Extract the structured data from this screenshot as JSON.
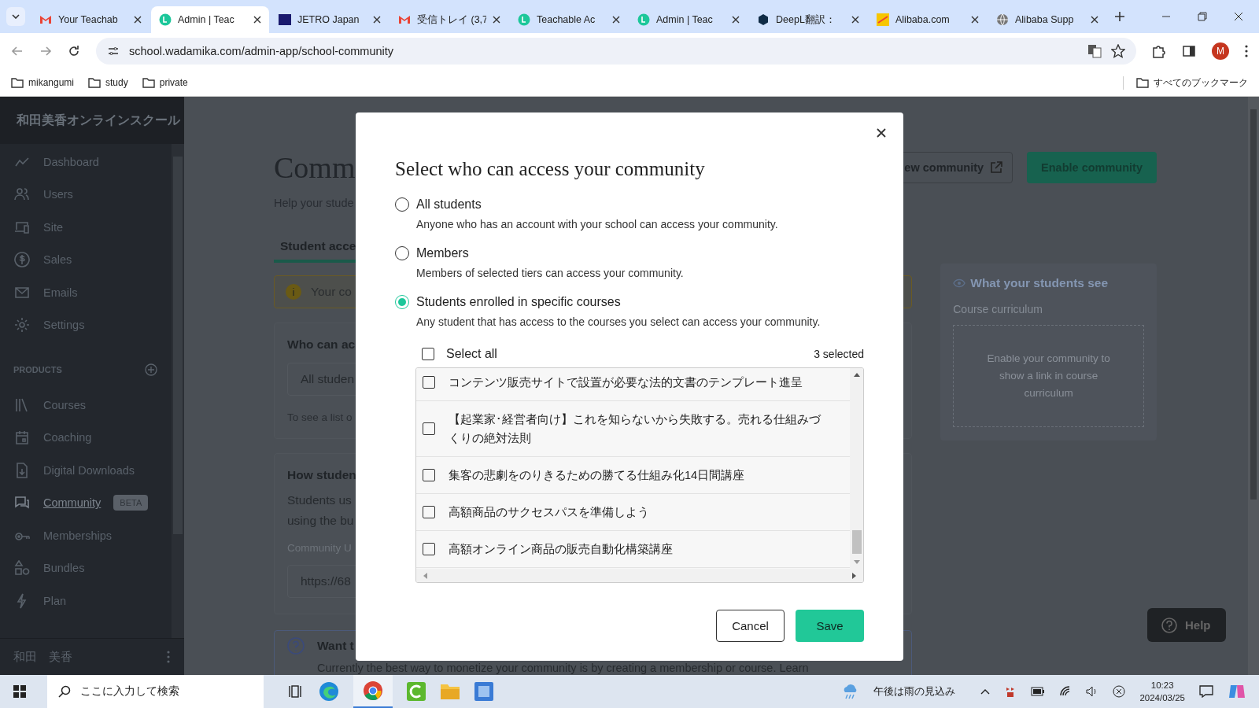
{
  "browser": {
    "tabs": [
      {
        "title": "Your Teachab",
        "kind": "gmail",
        "selected": false
      },
      {
        "title": "Admin | Teac",
        "kind": "teachable",
        "selected": true
      },
      {
        "title": "JETRO Japan",
        "kind": "jetro",
        "selected": false
      },
      {
        "title": "受信トレイ (3,7",
        "kind": "gmail",
        "selected": false
      },
      {
        "title": "Teachable Ac",
        "kind": "teachable",
        "selected": false
      },
      {
        "title": "Admin | Teac",
        "kind": "teachable",
        "selected": false
      },
      {
        "title": "DeepL翻訳：",
        "kind": "deepl",
        "selected": false
      },
      {
        "title": "Alibaba.com",
        "kind": "alibaba",
        "selected": false
      },
      {
        "title": "Alibaba Supp",
        "kind": "globe",
        "selected": false
      }
    ],
    "address": "school.wadamika.com/admin-app/school-community",
    "profile": "M",
    "bookmarks": [
      "mikangumi",
      "study",
      "private"
    ],
    "all_bookmarks": "すべてのブックマーク"
  },
  "sidebar": {
    "brand": "和田美香オンラインスクール",
    "items": [
      {
        "label": "Dashboard",
        "selected": false
      },
      {
        "label": "Users",
        "selected": false
      },
      {
        "label": "Site",
        "selected": false
      },
      {
        "label": "Sales",
        "selected": false
      },
      {
        "label": "Emails",
        "selected": false
      },
      {
        "label": "Settings",
        "selected": false
      }
    ],
    "products_heading": "PRODUCTS",
    "products": [
      {
        "label": "Courses",
        "selected": false
      },
      {
        "label": "Coaching",
        "selected": false
      },
      {
        "label": "Digital Downloads",
        "selected": false
      },
      {
        "label": "Community",
        "selected": true,
        "badge": "BETA"
      },
      {
        "label": "Memberships",
        "selected": false
      },
      {
        "label": "Bundles",
        "selected": false
      },
      {
        "label": "Plan",
        "selected": false
      }
    ],
    "user": "和田　美香"
  },
  "page": {
    "title": "Comm",
    "subtitle": "Help your stude",
    "tab": "Student acce",
    "notice": "Your co",
    "access_card": {
      "heading": "Who can ac",
      "select_value": "All studen",
      "note": "To see a list o"
    },
    "how_card": {
      "heading": "How studen",
      "lines": [
        "Students us",
        "using the bu"
      ],
      "url_label": "Community U",
      "url_value": "https://68"
    },
    "promo": {
      "heading": "Want t",
      "text": "Currently the best way to monetize your community is by creating a membership or course. Learn"
    },
    "view_button": "ew community",
    "enable_button": "Enable community",
    "preview": {
      "heading": "What your students see",
      "label": "Course curriculum",
      "placeholder": "Enable your community to show a link in course curriculum"
    },
    "help": "Help"
  },
  "dialog": {
    "title": "Select who can access your community",
    "options": [
      {
        "label": "All students",
        "description": "Anyone who has an account with your school can access your community.",
        "selected": false
      },
      {
        "label": "Members",
        "description": "Members of selected tiers can access your community.",
        "selected": false
      },
      {
        "label": "Students enrolled in specific courses",
        "description": "Any student that has access to the courses you select can access your community.",
        "selected": true
      }
    ],
    "select_all": {
      "label": "Select all",
      "checked": false
    },
    "selected_count": "3 selected",
    "courses": [
      {
        "title": "コンテンツ販売サイトで設置が必要な法的文書のテンプレート進呈",
        "checked": false
      },
      {
        "title": "【起業家･経営者向け】これを知らないから失敗する。売れる仕組みづくりの絶対法則",
        "checked": false
      },
      {
        "title": "集客の悲劇をのりきるための勝てる仕組み化14日間講座",
        "checked": false
      },
      {
        "title": "高額商品のサクセスパスを準備しよう",
        "checked": false
      },
      {
        "title": "高額オンライン商品の販売自動化構築講座",
        "checked": false
      }
    ],
    "cancel": "Cancel",
    "save": "Save"
  },
  "taskbar": {
    "search_placeholder": "ここに入力して検索",
    "weather": "午後は雨の見込み",
    "time": "10:23",
    "date": "2024/03/25"
  }
}
